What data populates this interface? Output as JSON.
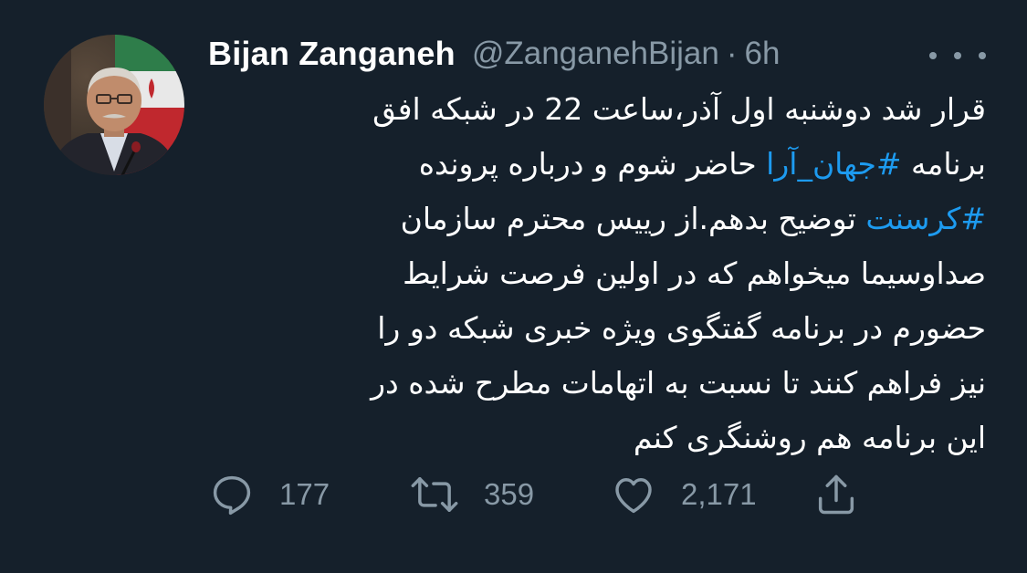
{
  "tweet": {
    "author": {
      "display_name": "Bijan Zanganeh",
      "handle": "@ZanganehBijan",
      "separator": "·",
      "time": "6h"
    },
    "body": {
      "lines": [
        [
          {
            "text": "قرار شد دوشنبه اول آذر،ساعت 22 در شبکه افق"
          }
        ],
        [
          {
            "text": "برنامه "
          },
          {
            "text": "#جهان_آرا",
            "hashtag": true
          },
          {
            "text": " حاضر شوم و درباره پرونده"
          }
        ],
        [
          {
            "text": "#کرسنت",
            "hashtag": true
          },
          {
            "text": " توضیح بدهم.از رییس محترم سازمان"
          }
        ],
        [
          {
            "text": "صداوسیما میخواهم که در اولین فرصت شرایط"
          }
        ],
        [
          {
            "text": "حضورم در برنامه گفتگوی ویژه خبری شبکه دو را"
          }
        ],
        [
          {
            "text": "نیز فراهم کنند تا نسبت به اتهامات مطرح شده در"
          }
        ],
        [
          {
            "text": "این برنامه هم روشنگری کنم"
          }
        ]
      ]
    },
    "actions": {
      "reply": {
        "icon": "reply-icon",
        "count": "177"
      },
      "retweet": {
        "icon": "retweet-icon",
        "count": "359"
      },
      "like": {
        "icon": "heart-icon",
        "count": "2,171"
      },
      "share": {
        "icon": "share-icon"
      }
    },
    "colors": {
      "background": "#15202b",
      "text": "#ffffff",
      "muted": "#8899a6",
      "hashtag": "#1d9bf0"
    }
  }
}
